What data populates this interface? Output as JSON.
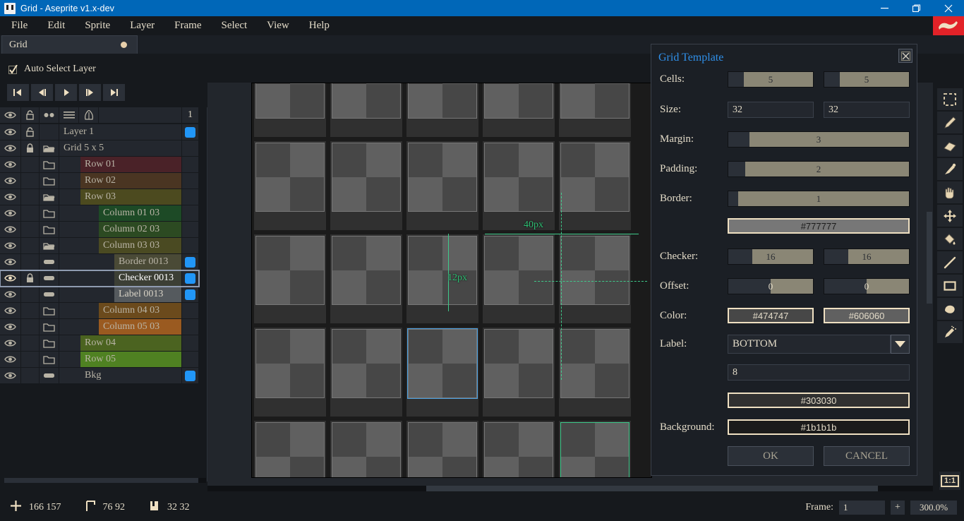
{
  "window": {
    "title": "Grid - Aseprite v1.x-dev",
    "app_icon": "aseprite-icon",
    "minimize_label": "minimize-icon",
    "maximize_label": "restore-icon",
    "close_label": "close-icon"
  },
  "menubar": {
    "items": [
      "File",
      "Edit",
      "Sprite",
      "Layer",
      "Frame",
      "Select",
      "View",
      "Help"
    ]
  },
  "tabs": [
    {
      "label": "Grid",
      "modified": true
    }
  ],
  "context_bar": {
    "auto_select_layer_label": "Auto Select Layer",
    "auto_select_layer_checked": true,
    "frame_buttons": [
      "first-frame",
      "previous-frame",
      "play",
      "next-frame",
      "last-frame"
    ]
  },
  "layers_panel": {
    "header": {
      "eye_icon": "eye-icon",
      "lock_icon": "unlock-icon",
      "link_icon": "continuous-icon",
      "menu_icon": "hamburger-icon",
      "onion_icon": "onionskin-icon",
      "frame_number": "1"
    },
    "rows": [
      {
        "name": "Layer 1",
        "indent": 0,
        "bg": "#23272e",
        "text": "#b9b4a6",
        "folder": "none",
        "has_lock": true,
        "lock": "unlock-icon",
        "has_color_dot": true,
        "selected": false
      },
      {
        "name": "Grid 5 x 5",
        "indent": 0,
        "bg": "#23272e",
        "text": "#b9b4a6",
        "folder": "open",
        "has_lock": true,
        "lock": "lock-icon",
        "has_color_dot": false,
        "selected": false
      },
      {
        "name": "Row 01",
        "indent": 1,
        "bg": "#4a2228",
        "text": "#b9b4a6",
        "folder": "closed",
        "has_lock": false,
        "lock": "",
        "has_color_dot": false,
        "selected": false
      },
      {
        "name": "Row 02",
        "indent": 1,
        "bg": "#4a3522",
        "text": "#b9b4a6",
        "folder": "closed",
        "has_lock": false,
        "lock": "",
        "has_color_dot": false,
        "selected": false
      },
      {
        "name": "Row 03",
        "indent": 1,
        "bg": "#4c4a1f",
        "text": "#b9b4a6",
        "folder": "open",
        "has_lock": false,
        "lock": "",
        "has_color_dot": false,
        "selected": false
      },
      {
        "name": "Column 01 03",
        "indent": 2,
        "bg": "#1d4a26",
        "text": "#b9b4a6",
        "folder": "closed",
        "has_lock": false,
        "lock": "",
        "has_color_dot": false,
        "selected": false
      },
      {
        "name": "Column 02 03",
        "indent": 2,
        "bg": "#2c4a22",
        "text": "#b9b4a6",
        "folder": "closed",
        "has_lock": false,
        "lock": "",
        "has_color_dot": false,
        "selected": false
      },
      {
        "name": "Column 03 03",
        "indent": 2,
        "bg": "#4a4a22",
        "text": "#b9b4a6",
        "folder": "open",
        "has_lock": false,
        "lock": "",
        "has_color_dot": false,
        "selected": false
      },
      {
        "name": "Border 0013",
        "indent": 3,
        "bg": "#4a4a36",
        "text": "#b9b4a6",
        "folder": "layer",
        "has_lock": false,
        "lock": "",
        "has_color_dot": true,
        "selected": false
      },
      {
        "name": "Checker 0013",
        "indent": 3,
        "bg": "#3c3f35",
        "text": "#ffffff",
        "folder": "layer",
        "has_lock": true,
        "lock": "lock-icon",
        "has_color_dot": true,
        "selected": true
      },
      {
        "name": "Label 0013",
        "indent": 3,
        "bg": "#555a5e",
        "text": "#d8d3c6",
        "folder": "layer",
        "has_lock": false,
        "lock": "",
        "has_color_dot": true,
        "selected": false
      },
      {
        "name": "Column 04 03",
        "indent": 2,
        "bg": "#6b4a1c",
        "text": "#b9b4a6",
        "folder": "closed",
        "has_lock": false,
        "lock": "",
        "has_color_dot": false,
        "selected": false
      },
      {
        "name": "Column 05 03",
        "indent": 2,
        "bg": "#9a5a20",
        "text": "#b9b4a6",
        "folder": "closed",
        "has_lock": false,
        "lock": "",
        "has_color_dot": false,
        "selected": false
      },
      {
        "name": "Row 04",
        "indent": 1,
        "bg": "#4b6320",
        "text": "#b9b4a6",
        "folder": "closed",
        "has_lock": false,
        "lock": "",
        "has_color_dot": false,
        "selected": false
      },
      {
        "name": "Row 05",
        "indent": 1,
        "bg": "#4f8122",
        "text": "#b9b4a6",
        "folder": "closed",
        "has_lock": false,
        "lock": "",
        "has_color_dot": false,
        "selected": false
      },
      {
        "name": "Bkg",
        "indent": 1,
        "bg": "#23272e",
        "text": "#b9b4a6",
        "folder": "layer",
        "has_lock": false,
        "lock": "",
        "has_color_dot": true,
        "selected": false
      }
    ]
  },
  "canvas": {
    "measurements": [
      {
        "label": "40px",
        "orientation": "horizontal"
      },
      {
        "label": "12px",
        "orientation": "vertical"
      }
    ],
    "cell_color_a": "#474747",
    "cell_color_b": "#606060",
    "cell_border_color": "#777777",
    "cell_bg_color": "#303030",
    "background_color": "#1b1b1b",
    "selection_color": "#4a9fe0",
    "hover_color": "#3ec98a"
  },
  "tools": [
    "rectangular-marquee-icon",
    "pencil-icon",
    "eraser-icon",
    "eyedropper-icon",
    "hand-icon",
    "move-icon",
    "paint-bucket-icon",
    "line-icon",
    "rectangle-icon",
    "lasso-icon",
    "spray-icon"
  ],
  "zoom_reset": {
    "label": "1:1"
  },
  "dialog": {
    "title": "Grid Template",
    "close_icon": "close-icon",
    "fields": {
      "cells_label": "Cells:",
      "cells_x": "5",
      "cells_y": "5",
      "size_label": "Size:",
      "size_x": "32",
      "size_y": "32",
      "margin_label": "Margin:",
      "margin": "3",
      "padding_label": "Padding:",
      "padding": "2",
      "border_label": "Border:",
      "border": "1",
      "border_color": "#777777",
      "checker_label": "Checker:",
      "checker_x": "16",
      "checker_y": "16",
      "offset_label": "Offset:",
      "offset_x": "0",
      "offset_y": "0",
      "color_label": "Color:",
      "color_1": "#474747",
      "color_2": "#606060",
      "label_label": "Label:",
      "label_position": "BOTTOM",
      "label_size": "8",
      "label_color": "#303030",
      "background_label": "Background:",
      "background_color": "#1b1b1b",
      "ok_label": "OK",
      "cancel_label": "CANCEL"
    }
  },
  "statusbar": {
    "cursor_icon": "crosshair-icon",
    "cursor_pos": "166 157",
    "offset_icon": "corner-icon",
    "offset_pos": "76 92",
    "size_icon": "sprite-size-icon",
    "size_value": "32 32",
    "frame_label": "Frame:",
    "frame_value": "1",
    "plus_label": "+",
    "zoom_value": "300.0%"
  }
}
